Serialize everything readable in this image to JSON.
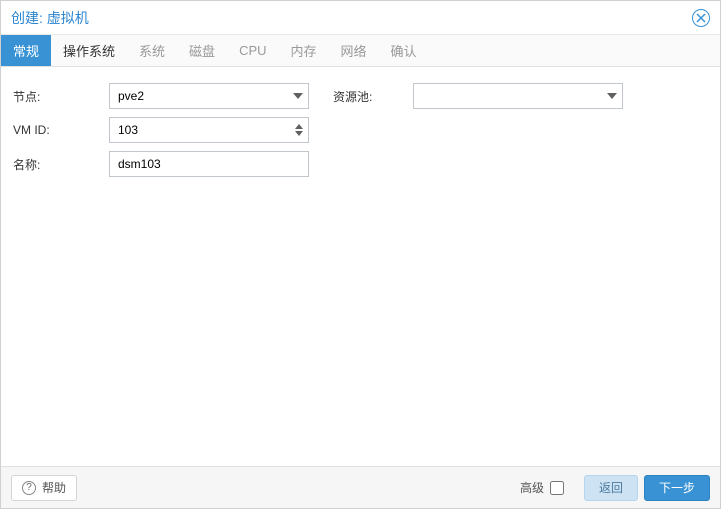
{
  "window": {
    "title": "创建: 虚拟机"
  },
  "tabs": [
    {
      "label": "常规",
      "state": "active"
    },
    {
      "label": "操作系统",
      "state": "enabled"
    },
    {
      "label": "系统",
      "state": "disabled"
    },
    {
      "label": "磁盘",
      "state": "disabled"
    },
    {
      "label": "CPU",
      "state": "disabled"
    },
    {
      "label": "内存",
      "state": "disabled"
    },
    {
      "label": "网络",
      "state": "disabled"
    },
    {
      "label": "确认",
      "state": "disabled"
    }
  ],
  "form": {
    "node": {
      "label": "节点:",
      "value": "pve2"
    },
    "vmid": {
      "label": "VM ID:",
      "value": "103"
    },
    "name": {
      "label": "名称:",
      "value": "dsm103"
    },
    "pool": {
      "label": "资源池:",
      "value": ""
    }
  },
  "footer": {
    "help": "帮助",
    "advanced": "高级",
    "back": "返回",
    "next": "下一步"
  }
}
